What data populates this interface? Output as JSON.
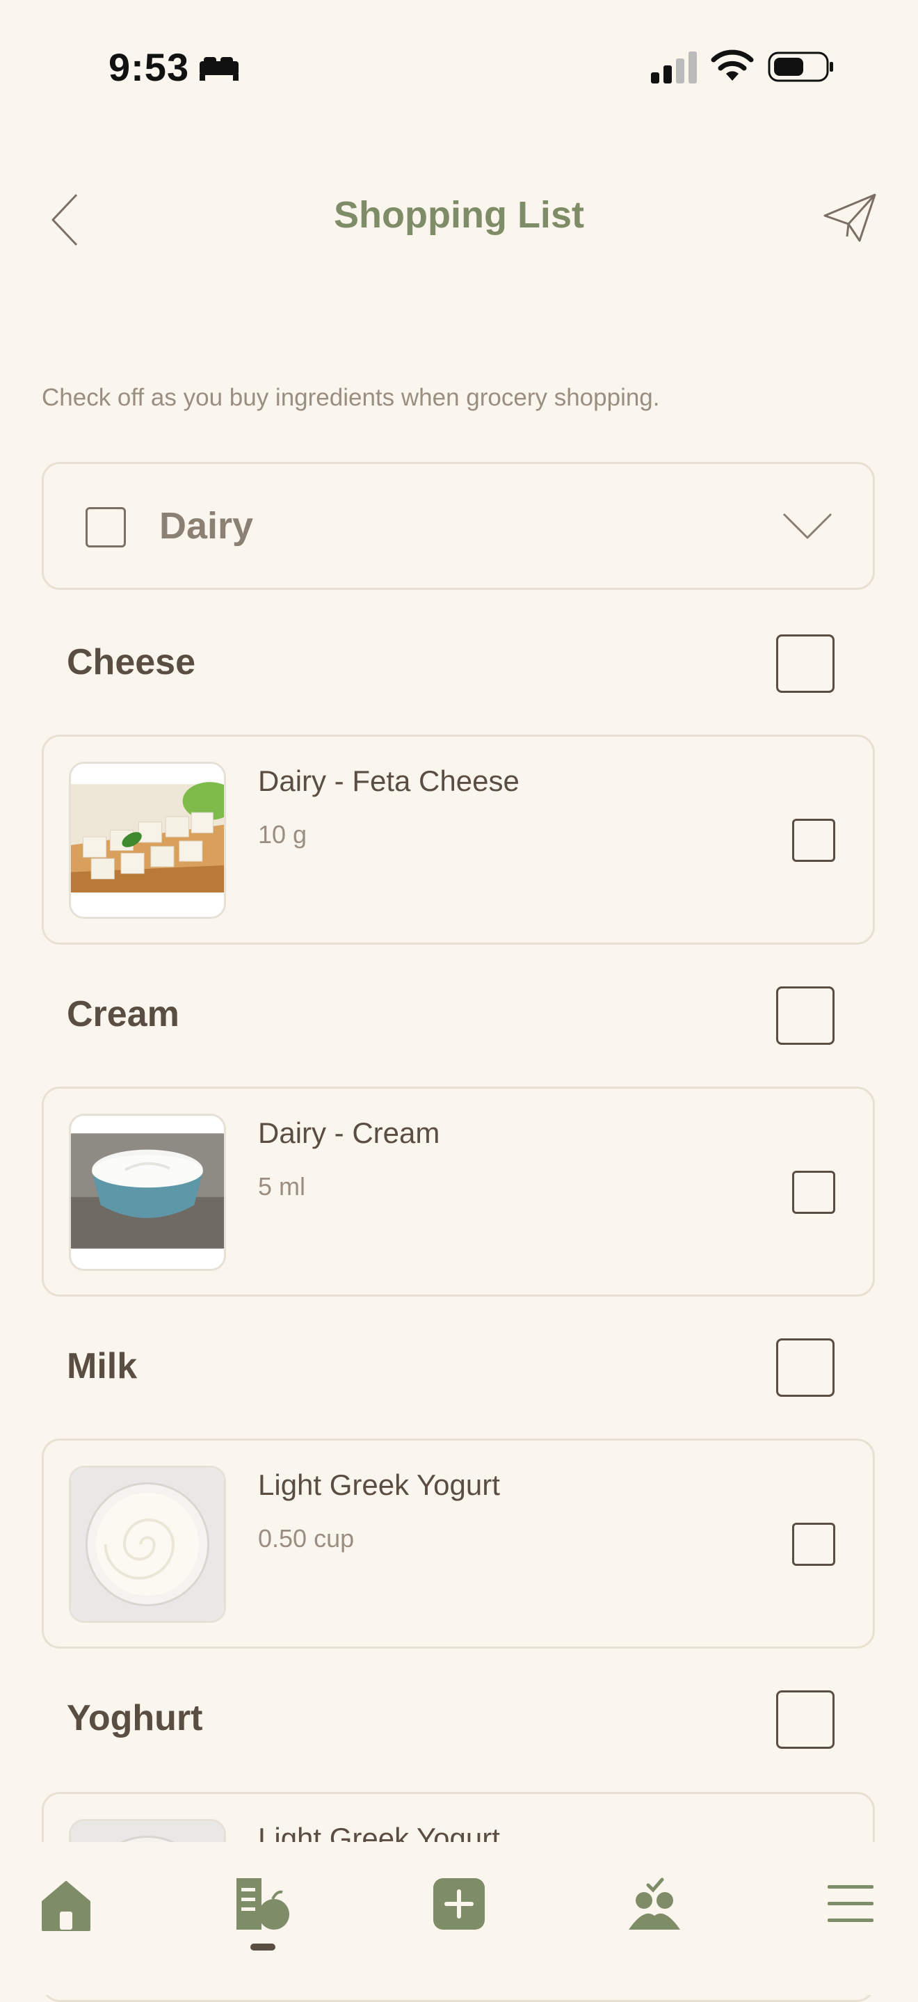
{
  "status_bar": {
    "time": "9:53"
  },
  "header": {
    "title": "Shopping List"
  },
  "subtitle": "Check off as you buy ingredients when grocery shopping.",
  "category": {
    "label": "Dairy",
    "checked": false,
    "expanded": true
  },
  "groups": [
    {
      "title": "Cheese",
      "item": {
        "name": "Dairy - Feta Cheese",
        "quantity": "10 g",
        "image": "feta-cheese"
      }
    },
    {
      "title": "Cream",
      "item": {
        "name": "Dairy - Cream",
        "quantity": "5 ml",
        "image": "cream-bowl"
      }
    },
    {
      "title": "Milk",
      "item": {
        "name": "Light Greek Yogurt",
        "quantity": "0.50 cup",
        "image": "yogurt-bowl"
      }
    },
    {
      "title": "Yoghurt",
      "item": {
        "name": "Light Greek Yogurt",
        "quantity": "",
        "image": "yogurt-bowl"
      }
    }
  ],
  "nav": {
    "items": [
      "home-icon",
      "shopping-list-icon",
      "add-icon",
      "community-icon",
      "menu-icon"
    ],
    "active": "shopping-list-icon"
  },
  "colors": {
    "accent": "#7f8c68",
    "text": "#5a4d42",
    "muted": "#9a8e80",
    "background": "#faf6ee",
    "border": "#e8e0d0"
  }
}
